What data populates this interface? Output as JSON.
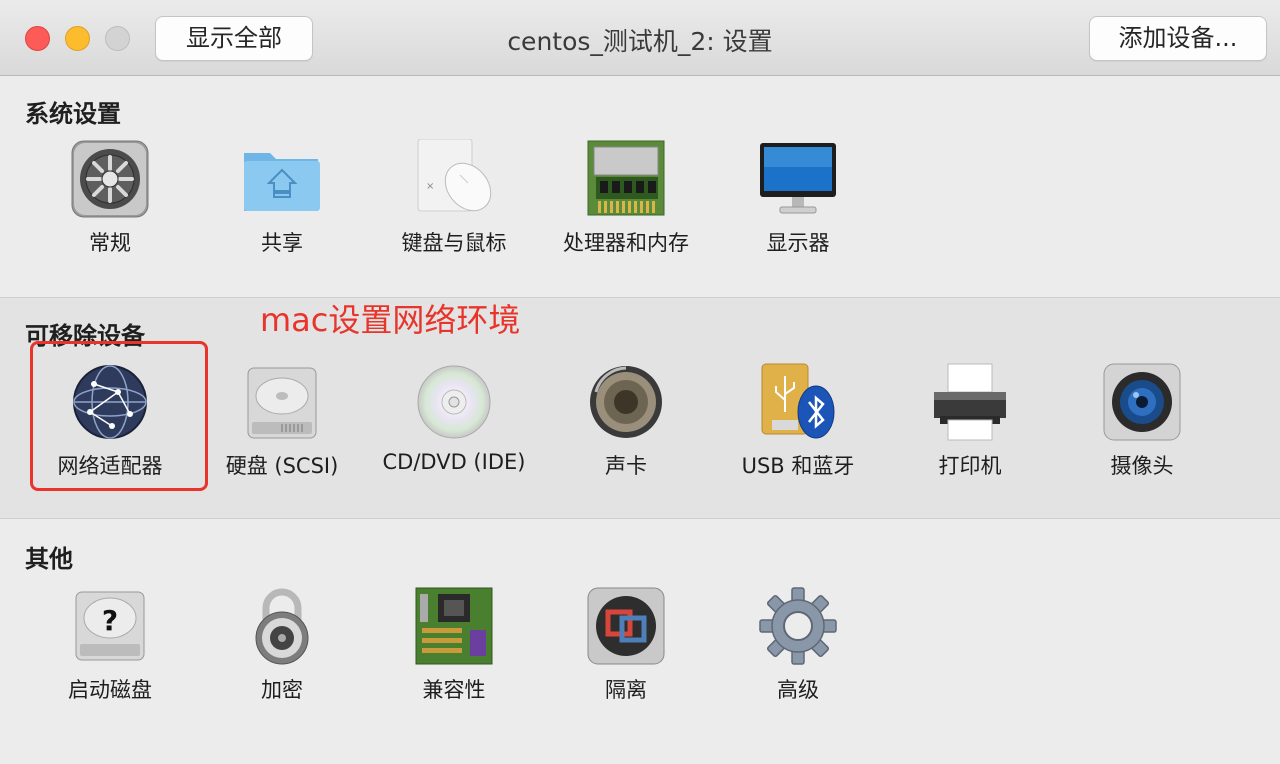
{
  "window": {
    "title": "centos_测试机_2: 设置",
    "show_all_label": "显示全部",
    "add_device_label": "添加设备..."
  },
  "sections": {
    "system": {
      "title": "系统设置",
      "items": [
        {
          "label": "常规",
          "icon": "gear-general-icon"
        },
        {
          "label": "共享",
          "icon": "shared-folder-icon"
        },
        {
          "label": "键盘与鼠标",
          "icon": "keyboard-mouse-icon"
        },
        {
          "label": "处理器和内存",
          "icon": "memory-chip-icon"
        },
        {
          "label": "显示器",
          "icon": "display-icon"
        }
      ]
    },
    "removable": {
      "title": "可移除设备",
      "items": [
        {
          "label": "网络适配器",
          "icon": "network-globe-icon"
        },
        {
          "label": "硬盘 (SCSI)",
          "icon": "hard-disk-icon"
        },
        {
          "label": "CD/DVD (IDE)",
          "icon": "cd-dvd-icon"
        },
        {
          "label": "声卡",
          "icon": "speaker-icon"
        },
        {
          "label": "USB 和蓝牙",
          "icon": "usb-bluetooth-icon"
        },
        {
          "label": "打印机",
          "icon": "printer-icon"
        },
        {
          "label": "摄像头",
          "icon": "camera-icon"
        }
      ]
    },
    "other": {
      "title": "其他",
      "items": [
        {
          "label": "启动磁盘",
          "icon": "startup-disk-icon"
        },
        {
          "label": "加密",
          "icon": "padlock-icon"
        },
        {
          "label": "兼容性",
          "icon": "motherboard-icon"
        },
        {
          "label": "隔离",
          "icon": "isolation-icon"
        },
        {
          "label": "高级",
          "icon": "advanced-gear-icon"
        }
      ]
    }
  },
  "annotation": {
    "text": "mac设置网络环境",
    "color": "#e8342a"
  }
}
